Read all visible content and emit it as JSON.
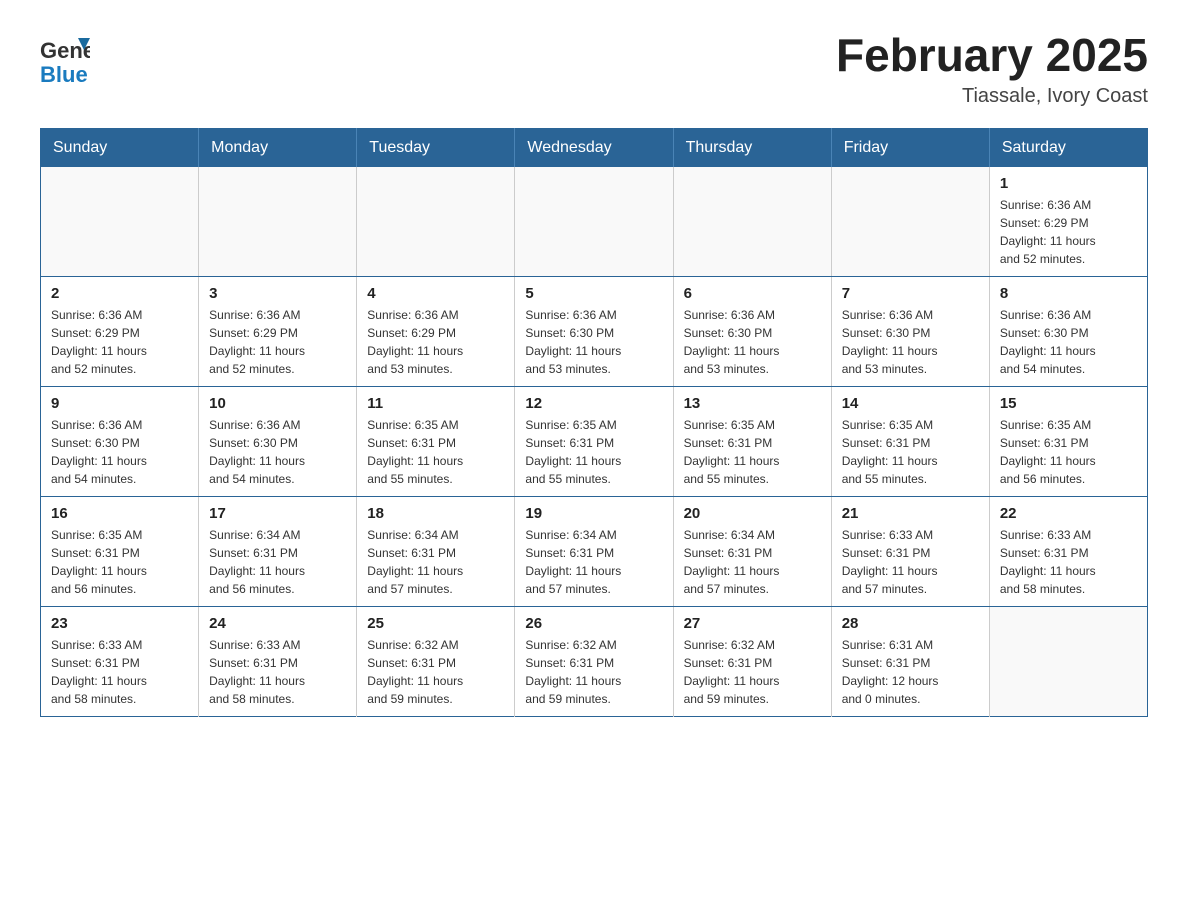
{
  "header": {
    "logo_general": "General",
    "logo_blue": "Blue",
    "title": "February 2025",
    "subtitle": "Tiassale, Ivory Coast"
  },
  "days_of_week": [
    "Sunday",
    "Monday",
    "Tuesday",
    "Wednesday",
    "Thursday",
    "Friday",
    "Saturday"
  ],
  "weeks": [
    {
      "days": [
        {
          "number": "",
          "info": ""
        },
        {
          "number": "",
          "info": ""
        },
        {
          "number": "",
          "info": ""
        },
        {
          "number": "",
          "info": ""
        },
        {
          "number": "",
          "info": ""
        },
        {
          "number": "",
          "info": ""
        },
        {
          "number": "1",
          "info": "Sunrise: 6:36 AM\nSunset: 6:29 PM\nDaylight: 11 hours\nand 52 minutes."
        }
      ]
    },
    {
      "days": [
        {
          "number": "2",
          "info": "Sunrise: 6:36 AM\nSunset: 6:29 PM\nDaylight: 11 hours\nand 52 minutes."
        },
        {
          "number": "3",
          "info": "Sunrise: 6:36 AM\nSunset: 6:29 PM\nDaylight: 11 hours\nand 52 minutes."
        },
        {
          "number": "4",
          "info": "Sunrise: 6:36 AM\nSunset: 6:29 PM\nDaylight: 11 hours\nand 53 minutes."
        },
        {
          "number": "5",
          "info": "Sunrise: 6:36 AM\nSunset: 6:30 PM\nDaylight: 11 hours\nand 53 minutes."
        },
        {
          "number": "6",
          "info": "Sunrise: 6:36 AM\nSunset: 6:30 PM\nDaylight: 11 hours\nand 53 minutes."
        },
        {
          "number": "7",
          "info": "Sunrise: 6:36 AM\nSunset: 6:30 PM\nDaylight: 11 hours\nand 53 minutes."
        },
        {
          "number": "8",
          "info": "Sunrise: 6:36 AM\nSunset: 6:30 PM\nDaylight: 11 hours\nand 54 minutes."
        }
      ]
    },
    {
      "days": [
        {
          "number": "9",
          "info": "Sunrise: 6:36 AM\nSunset: 6:30 PM\nDaylight: 11 hours\nand 54 minutes."
        },
        {
          "number": "10",
          "info": "Sunrise: 6:36 AM\nSunset: 6:30 PM\nDaylight: 11 hours\nand 54 minutes."
        },
        {
          "number": "11",
          "info": "Sunrise: 6:35 AM\nSunset: 6:31 PM\nDaylight: 11 hours\nand 55 minutes."
        },
        {
          "number": "12",
          "info": "Sunrise: 6:35 AM\nSunset: 6:31 PM\nDaylight: 11 hours\nand 55 minutes."
        },
        {
          "number": "13",
          "info": "Sunrise: 6:35 AM\nSunset: 6:31 PM\nDaylight: 11 hours\nand 55 minutes."
        },
        {
          "number": "14",
          "info": "Sunrise: 6:35 AM\nSunset: 6:31 PM\nDaylight: 11 hours\nand 55 minutes."
        },
        {
          "number": "15",
          "info": "Sunrise: 6:35 AM\nSunset: 6:31 PM\nDaylight: 11 hours\nand 56 minutes."
        }
      ]
    },
    {
      "days": [
        {
          "number": "16",
          "info": "Sunrise: 6:35 AM\nSunset: 6:31 PM\nDaylight: 11 hours\nand 56 minutes."
        },
        {
          "number": "17",
          "info": "Sunrise: 6:34 AM\nSunset: 6:31 PM\nDaylight: 11 hours\nand 56 minutes."
        },
        {
          "number": "18",
          "info": "Sunrise: 6:34 AM\nSunset: 6:31 PM\nDaylight: 11 hours\nand 57 minutes."
        },
        {
          "number": "19",
          "info": "Sunrise: 6:34 AM\nSunset: 6:31 PM\nDaylight: 11 hours\nand 57 minutes."
        },
        {
          "number": "20",
          "info": "Sunrise: 6:34 AM\nSunset: 6:31 PM\nDaylight: 11 hours\nand 57 minutes."
        },
        {
          "number": "21",
          "info": "Sunrise: 6:33 AM\nSunset: 6:31 PM\nDaylight: 11 hours\nand 57 minutes."
        },
        {
          "number": "22",
          "info": "Sunrise: 6:33 AM\nSunset: 6:31 PM\nDaylight: 11 hours\nand 58 minutes."
        }
      ]
    },
    {
      "days": [
        {
          "number": "23",
          "info": "Sunrise: 6:33 AM\nSunset: 6:31 PM\nDaylight: 11 hours\nand 58 minutes."
        },
        {
          "number": "24",
          "info": "Sunrise: 6:33 AM\nSunset: 6:31 PM\nDaylight: 11 hours\nand 58 minutes."
        },
        {
          "number": "25",
          "info": "Sunrise: 6:32 AM\nSunset: 6:31 PM\nDaylight: 11 hours\nand 59 minutes."
        },
        {
          "number": "26",
          "info": "Sunrise: 6:32 AM\nSunset: 6:31 PM\nDaylight: 11 hours\nand 59 minutes."
        },
        {
          "number": "27",
          "info": "Sunrise: 6:32 AM\nSunset: 6:31 PM\nDaylight: 11 hours\nand 59 minutes."
        },
        {
          "number": "28",
          "info": "Sunrise: 6:31 AM\nSunset: 6:31 PM\nDaylight: 12 hours\nand 0 minutes."
        },
        {
          "number": "",
          "info": ""
        }
      ]
    }
  ]
}
